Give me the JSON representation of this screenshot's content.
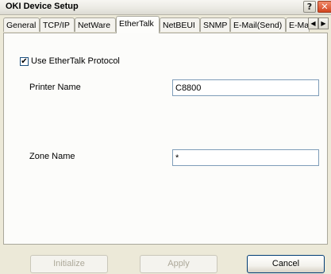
{
  "window": {
    "title": "OKI Device Setup",
    "help_label": "?",
    "close_label": "✕"
  },
  "tabs": [
    {
      "label": "General",
      "active": false
    },
    {
      "label": "TCP/IP",
      "active": false
    },
    {
      "label": "NetWare",
      "active": false
    },
    {
      "label": "EtherTalk",
      "active": true
    },
    {
      "label": "NetBEUI",
      "active": false
    },
    {
      "label": "SNMP",
      "active": false
    },
    {
      "label": "E-Mail(Send)",
      "active": false
    },
    {
      "label": "E-Mail(",
      "active": false
    }
  ],
  "tab_scroll": {
    "left_icon": "◀",
    "right_icon": "▶"
  },
  "ethertalk": {
    "use_protocol_label": "Use EtherTalk Protocol",
    "use_protocol_checked": true,
    "check_mark": "✔",
    "printer_name_label": "Printer Name",
    "printer_name_value": "C8800",
    "zone_name_label": "Zone Name",
    "zone_name_value": "*"
  },
  "buttons": {
    "initialize": "Initialize",
    "apply": "Apply",
    "cancel": "Cancel"
  }
}
